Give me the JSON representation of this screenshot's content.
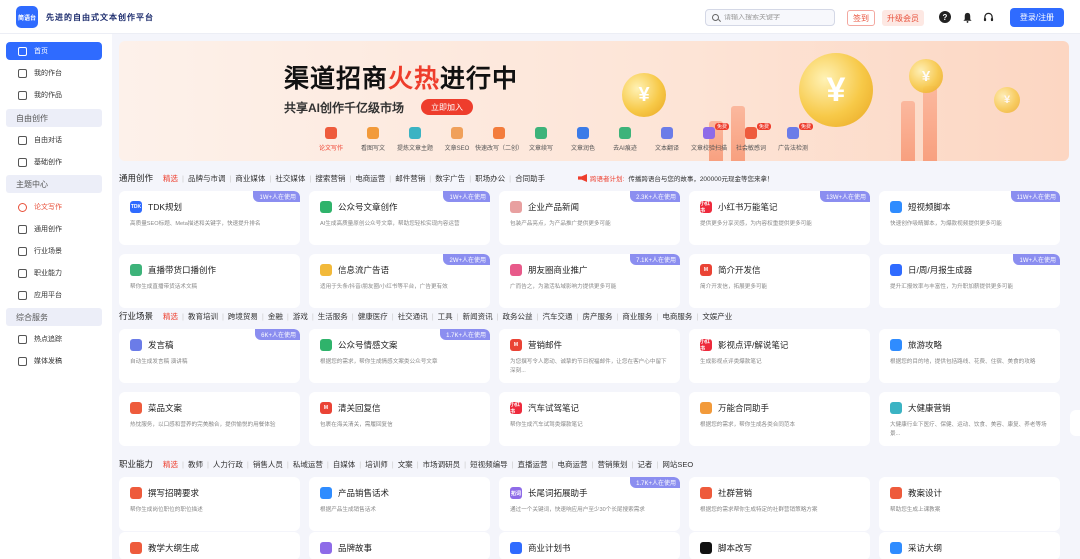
{
  "header": {
    "logo_text": "简语台",
    "slogan": "先进的自由式文本创作平台",
    "search_placeholder": "请输入搜索关键字",
    "signin": "签到",
    "vip": "升级会员",
    "login": "登录/注册"
  },
  "sidebar": {
    "home": "首页",
    "my_workspace": "我的作台",
    "my_works": "我的作品",
    "free_create_head": "自由创作",
    "free_chat": "自由对话",
    "basic_create": "基础创作",
    "topic_head": "主题中心",
    "essay": "论文写作",
    "general_create": "通用创作",
    "industry": "行业场景",
    "skills": "职业能力",
    "platform": "应用平台",
    "service_head": "综合服务",
    "hot_track": "热点追踪",
    "media": "媒体发稿"
  },
  "banner": {
    "title_a": "渠道招商",
    "title_hot": "火热",
    "title_b": "进行中",
    "subtitle": "共享AI创作千亿级市场",
    "join": "立即加入",
    "tools": [
      {
        "label": "论文写作",
        "color": "#ee5b3c",
        "red": true,
        "free": ""
      },
      {
        "label": "看图写文",
        "color": "#f29a3a",
        "red": false,
        "free": ""
      },
      {
        "label": "提炼文章主题",
        "color": "#3bb3c3",
        "red": false,
        "free": ""
      },
      {
        "label": "文章SEO",
        "color": "#f0a05a",
        "red": false,
        "free": ""
      },
      {
        "label": "快速改写（二创）",
        "color": "#f37c3c",
        "red": false,
        "free": ""
      },
      {
        "label": "文章续写",
        "color": "#3db37a",
        "red": false,
        "free": ""
      },
      {
        "label": "文章润色",
        "color": "#3b7be8",
        "red": false,
        "free": ""
      },
      {
        "label": "去AI痕迹",
        "color": "#3db37a",
        "red": false,
        "free": ""
      },
      {
        "label": "文本翻译",
        "color": "#6b7ce8",
        "red": false,
        "free": ""
      },
      {
        "label": "文章校验扫描",
        "color": "#8e6be8",
        "red": false,
        "free": "免费"
      },
      {
        "label": "社会敏感词",
        "color": "#ee5b3c",
        "red": false,
        "free": "免费"
      },
      {
        "label": "广告法检测",
        "color": "#6b7ce8",
        "red": false,
        "free": "免费"
      }
    ]
  },
  "general": {
    "title": "通用创作",
    "cats": [
      "精选",
      "品牌与市调",
      "商业媒体",
      "社交媒体",
      "搜索营销",
      "电商运营",
      "邮件营销",
      "数字广告",
      "职场办公",
      "合同助手"
    ],
    "notice_red": "跨语者计划:",
    "notice": "传播跨语台与您的故事，200000元现金等您来拿！",
    "cards": [
      {
        "title": "TDK规划",
        "desc": "高质量SEO标题、Meta描述和关键字，快速提升排名",
        "badge": "1W+人在使用",
        "icon": "TDK",
        "color": "#2f6bff"
      },
      {
        "title": "公众号文章创作",
        "desc": "AI生成高质量原创公众号文章，帮助您轻松实现内容运营",
        "badge": "1W+人在使用",
        "icon": "",
        "color": "#2fb36b"
      },
      {
        "title": "企业产品新闻",
        "desc": "包装产品亮点，为产品推广提供更多可能",
        "badge": "2.3K+人在使用",
        "icon": "",
        "color": "#e8a0a0"
      },
      {
        "title": "小红书万能笔记",
        "desc": "提供更多分享灵感，为内容权重提供更多可能",
        "badge": "13W+人在使用",
        "icon": "小红书",
        "color": "#ee2a3c"
      },
      {
        "title": "短视频脚本",
        "desc": "快速创作吸睛脚本，为爆款视频提供更多可能",
        "badge": "11W+人在使用",
        "icon": "",
        "color": "#2f8cff"
      },
      {
        "title": "直播带货口播创作",
        "desc": "帮你生成直播带货话术文稿",
        "badge": "",
        "icon": "",
        "color": "#3db37a"
      },
      {
        "title": "信息流广告语",
        "desc": "适用于头条/抖音/朋友圈/小红书等平台，广告更有效",
        "badge": "2W+人在使用",
        "icon": "",
        "color": "#f2b93a"
      },
      {
        "title": "朋友圈商业推广",
        "desc": "广而告之，为激活私域影响力提供更多可能",
        "badge": "7.1K+人在使用",
        "icon": "",
        "color": "#e85a8a"
      },
      {
        "title": "简介开发信",
        "desc": "简介开发信，拓展更多可能",
        "badge": "",
        "icon": "M",
        "color": "#ea4335"
      },
      {
        "title": "日/周/月报生成器",
        "desc": "提升汇报效率与丰富性，为升职加薪提供更多可能",
        "badge": "1W+人在使用",
        "icon": "",
        "color": "#2f6bff"
      }
    ]
  },
  "industry": {
    "title": "行业场景",
    "cats": [
      "精选",
      "教育培训",
      "跨境贸易",
      "金融",
      "游戏",
      "生活服务",
      "健康医疗",
      "社交通讯",
      "工具",
      "新闻资讯",
      "政务公益",
      "汽车交通",
      "房产服务",
      "商业服务",
      "电商服务",
      "文娱产业"
    ],
    "cards": [
      {
        "title": "发言稿",
        "desc": "自动生成发言稿 演讲稿",
        "badge": "6K+人在使用",
        "icon": "",
        "color": "#6b7ce8"
      },
      {
        "title": "公众号情感文案",
        "desc": "根据您的需求，帮你生成情感文案类公众号文章",
        "badge": "1.7K+人在使用",
        "icon": "",
        "color": "#2fb36b"
      },
      {
        "title": "营销邮件",
        "desc": "为您撰写令人愿动、诚挚的节日祝福邮件，让您在客户心中留下深刻...",
        "badge": "",
        "icon": "M",
        "color": "#ea4335"
      },
      {
        "title": "影视点评/解说笔记",
        "desc": "生成影视点评类爆款笔记",
        "badge": "",
        "icon": "小红书",
        "color": "#ee2a3c"
      },
      {
        "title": "旅游攻略",
        "desc": "根据您的目的地，提供包括路线、花费、住宿、美食的攻略",
        "badge": "",
        "icon": "",
        "color": "#2f8cff"
      },
      {
        "title": "菜品文案",
        "desc": "热忱服务，以口感和营养的完美融合，提供愉悦的用餐体验",
        "badge": "",
        "icon": "",
        "color": "#ee5b3c"
      },
      {
        "title": "清关回复信",
        "desc": "包裹在海关清关，需履回复信",
        "badge": "",
        "icon": "M",
        "color": "#ea4335"
      },
      {
        "title": "汽车试驾笔记",
        "desc": "帮你生成汽车试驾类爆款笔记",
        "badge": "",
        "icon": "小红书",
        "color": "#ee2a3c"
      },
      {
        "title": "万能合同助手",
        "desc": "根据您的需求，帮你生成各类合同范本",
        "badge": "",
        "icon": "",
        "color": "#f29a3a"
      },
      {
        "title": "大健康营销",
        "desc": "大健康行业下医疗、保健、运动、饮食、美容、康复、养老等场景...",
        "badge": "",
        "icon": "",
        "color": "#3bb3c3"
      }
    ]
  },
  "skills": {
    "title": "职业能力",
    "cats": [
      "精选",
      "教师",
      "人力行政",
      "销售人员",
      "私域运营",
      "自媒体",
      "培训师",
      "文案",
      "市场调研员",
      "短视频编导",
      "直播运营",
      "电商运营",
      "营销策划",
      "记者",
      "网站SEO"
    ],
    "cards": [
      {
        "title": "撰写招聘要求",
        "desc": "帮你生成岗位职位的职位描述",
        "badge": "",
        "icon": "",
        "color": "#ee5b3c"
      },
      {
        "title": "产品销售话术",
        "desc": "根据产品生成销售话术",
        "badge": "",
        "icon": "",
        "color": "#2f8cff"
      },
      {
        "title": "长尾词拓展助手",
        "desc": "通过一个关键词，快速响应用户至少30个长尾搜索需求",
        "badge": "1.7K+人在使用",
        "icon": "拓词",
        "color": "#8e6be8"
      },
      {
        "title": "社群营销",
        "desc": "根据您的需求帮你生成特定的社群营销策略方案",
        "badge": "",
        "icon": "",
        "color": "#ee5b3c"
      },
      {
        "title": "教案设计",
        "desc": "帮助您生成上课教案",
        "badge": "",
        "icon": "",
        "color": "#ee5b3c"
      },
      {
        "title": "教学大纲生成",
        "desc": "",
        "badge": "",
        "icon": "",
        "color": "#ee5b3c"
      },
      {
        "title": "品牌故事",
        "desc": "",
        "badge": "",
        "icon": "",
        "color": "#8e6be8"
      },
      {
        "title": "商业计划书",
        "desc": "",
        "badge": "",
        "icon": "",
        "color": "#2f6bff"
      },
      {
        "title": "脚本改写",
        "desc": "",
        "badge": "",
        "icon": "",
        "color": "#111111"
      },
      {
        "title": "采访大纲",
        "desc": "",
        "badge": "",
        "icon": "",
        "color": "#2f8cff"
      }
    ]
  }
}
